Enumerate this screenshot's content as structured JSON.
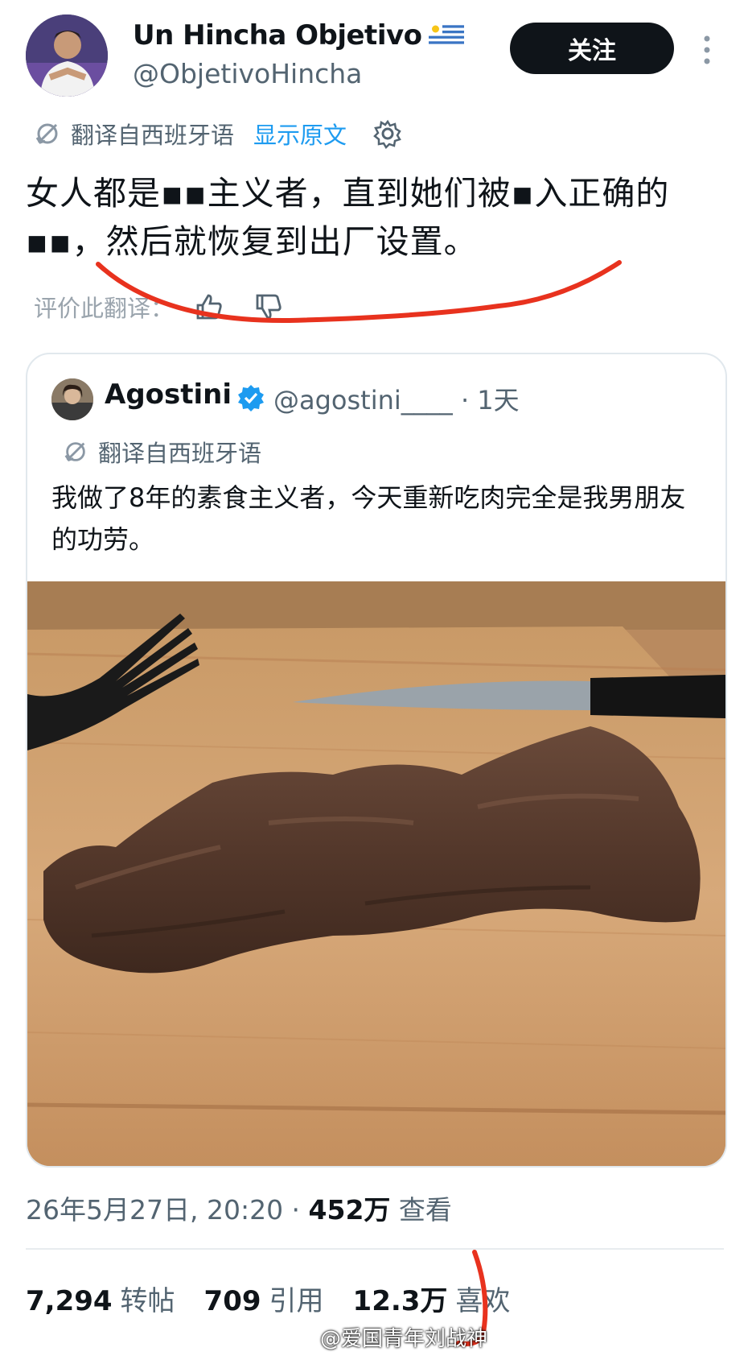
{
  "author": {
    "display_name": "Un Hincha Objetivo",
    "handle": "@ObjetivoHincha",
    "flag_icon": "uruguay-flag-icon"
  },
  "follow_button": {
    "label": "关注"
  },
  "translation": {
    "label": "翻译自西班牙语",
    "show_original": "显示原文"
  },
  "tweet_text": "女人都是▪▪主义者，直到她们被▪入正确的▪▪，然后就恢复到出厂设置。",
  "rate_translation": {
    "label": "评价此翻译："
  },
  "quote": {
    "display_name": "Agostini",
    "handle": "@agostini____",
    "time": "· 1天",
    "translation_label": "翻译自西班牙语",
    "text": "我做了8年的素食主义者，今天重新吃肉完全是我男朋友的功劳。"
  },
  "meta": {
    "datetime": "26年5月27日, 20:20 · ",
    "views_count": "452万",
    "views_label": " 查看"
  },
  "stats": {
    "reposts_count": "7,294",
    "reposts_label": "转帖",
    "quotes_count": "709",
    "quotes_label": "引用",
    "likes_count": "12.3万",
    "likes_label": "喜欢"
  },
  "watermark": "@爱国青年刘战神",
  "colors": {
    "accent": "#1d9bf0",
    "text": "#0f1419",
    "muted": "#536471",
    "annotation": "#e8321e"
  }
}
